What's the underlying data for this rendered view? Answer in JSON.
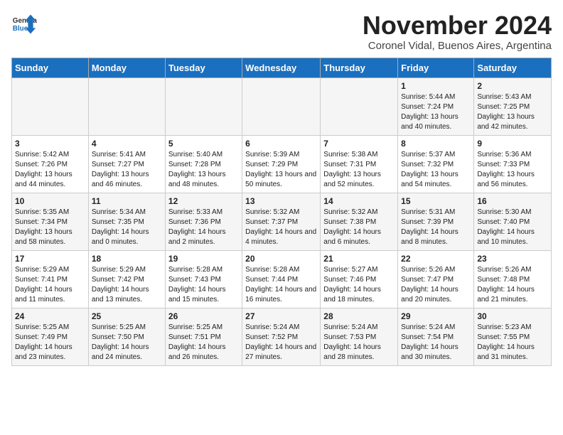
{
  "logo": {
    "general": "General",
    "blue": "Blue"
  },
  "header": {
    "month": "November 2024",
    "location": "Coronel Vidal, Buenos Aires, Argentina"
  },
  "columns": [
    "Sunday",
    "Monday",
    "Tuesday",
    "Wednesday",
    "Thursday",
    "Friday",
    "Saturday"
  ],
  "weeks": [
    [
      {
        "day": "",
        "info": ""
      },
      {
        "day": "",
        "info": ""
      },
      {
        "day": "",
        "info": ""
      },
      {
        "day": "",
        "info": ""
      },
      {
        "day": "",
        "info": ""
      },
      {
        "day": "1",
        "info": "Sunrise: 5:44 AM\nSunset: 7:24 PM\nDaylight: 13 hours and 40 minutes."
      },
      {
        "day": "2",
        "info": "Sunrise: 5:43 AM\nSunset: 7:25 PM\nDaylight: 13 hours and 42 minutes."
      }
    ],
    [
      {
        "day": "3",
        "info": "Sunrise: 5:42 AM\nSunset: 7:26 PM\nDaylight: 13 hours and 44 minutes."
      },
      {
        "day": "4",
        "info": "Sunrise: 5:41 AM\nSunset: 7:27 PM\nDaylight: 13 hours and 46 minutes."
      },
      {
        "day": "5",
        "info": "Sunrise: 5:40 AM\nSunset: 7:28 PM\nDaylight: 13 hours and 48 minutes."
      },
      {
        "day": "6",
        "info": "Sunrise: 5:39 AM\nSunset: 7:29 PM\nDaylight: 13 hours and 50 minutes."
      },
      {
        "day": "7",
        "info": "Sunrise: 5:38 AM\nSunset: 7:31 PM\nDaylight: 13 hours and 52 minutes."
      },
      {
        "day": "8",
        "info": "Sunrise: 5:37 AM\nSunset: 7:32 PM\nDaylight: 13 hours and 54 minutes."
      },
      {
        "day": "9",
        "info": "Sunrise: 5:36 AM\nSunset: 7:33 PM\nDaylight: 13 hours and 56 minutes."
      }
    ],
    [
      {
        "day": "10",
        "info": "Sunrise: 5:35 AM\nSunset: 7:34 PM\nDaylight: 13 hours and 58 minutes."
      },
      {
        "day": "11",
        "info": "Sunrise: 5:34 AM\nSunset: 7:35 PM\nDaylight: 14 hours and 0 minutes."
      },
      {
        "day": "12",
        "info": "Sunrise: 5:33 AM\nSunset: 7:36 PM\nDaylight: 14 hours and 2 minutes."
      },
      {
        "day": "13",
        "info": "Sunrise: 5:32 AM\nSunset: 7:37 PM\nDaylight: 14 hours and 4 minutes."
      },
      {
        "day": "14",
        "info": "Sunrise: 5:32 AM\nSunset: 7:38 PM\nDaylight: 14 hours and 6 minutes."
      },
      {
        "day": "15",
        "info": "Sunrise: 5:31 AM\nSunset: 7:39 PM\nDaylight: 14 hours and 8 minutes."
      },
      {
        "day": "16",
        "info": "Sunrise: 5:30 AM\nSunset: 7:40 PM\nDaylight: 14 hours and 10 minutes."
      }
    ],
    [
      {
        "day": "17",
        "info": "Sunrise: 5:29 AM\nSunset: 7:41 PM\nDaylight: 14 hours and 11 minutes."
      },
      {
        "day": "18",
        "info": "Sunrise: 5:29 AM\nSunset: 7:42 PM\nDaylight: 14 hours and 13 minutes."
      },
      {
        "day": "19",
        "info": "Sunrise: 5:28 AM\nSunset: 7:43 PM\nDaylight: 14 hours and 15 minutes."
      },
      {
        "day": "20",
        "info": "Sunrise: 5:28 AM\nSunset: 7:44 PM\nDaylight: 14 hours and 16 minutes."
      },
      {
        "day": "21",
        "info": "Sunrise: 5:27 AM\nSunset: 7:46 PM\nDaylight: 14 hours and 18 minutes."
      },
      {
        "day": "22",
        "info": "Sunrise: 5:26 AM\nSunset: 7:47 PM\nDaylight: 14 hours and 20 minutes."
      },
      {
        "day": "23",
        "info": "Sunrise: 5:26 AM\nSunset: 7:48 PM\nDaylight: 14 hours and 21 minutes."
      }
    ],
    [
      {
        "day": "24",
        "info": "Sunrise: 5:25 AM\nSunset: 7:49 PM\nDaylight: 14 hours and 23 minutes."
      },
      {
        "day": "25",
        "info": "Sunrise: 5:25 AM\nSunset: 7:50 PM\nDaylight: 14 hours and 24 minutes."
      },
      {
        "day": "26",
        "info": "Sunrise: 5:25 AM\nSunset: 7:51 PM\nDaylight: 14 hours and 26 minutes."
      },
      {
        "day": "27",
        "info": "Sunrise: 5:24 AM\nSunset: 7:52 PM\nDaylight: 14 hours and 27 minutes."
      },
      {
        "day": "28",
        "info": "Sunrise: 5:24 AM\nSunset: 7:53 PM\nDaylight: 14 hours and 28 minutes."
      },
      {
        "day": "29",
        "info": "Sunrise: 5:24 AM\nSunset: 7:54 PM\nDaylight: 14 hours and 30 minutes."
      },
      {
        "day": "30",
        "info": "Sunrise: 5:23 AM\nSunset: 7:55 PM\nDaylight: 14 hours and 31 minutes."
      }
    ]
  ]
}
